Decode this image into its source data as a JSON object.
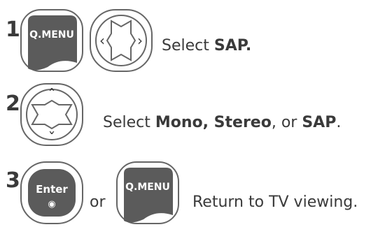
{
  "steps": [
    {
      "number": "1",
      "buttons": {
        "qmenu_label": "Q.MENU",
        "left_arrow": "‹",
        "right_arrow": "›"
      },
      "instruction": {
        "prefix": "Select ",
        "bold": "SAP."
      }
    },
    {
      "number": "2",
      "buttons": {
        "up_arrow": "ˆ",
        "down_arrow": "ˇ"
      },
      "instruction": {
        "prefix": "Select ",
        "bold1": "Mono, Stereo",
        "mid": ", or ",
        "bold2": "SAP",
        "suffix": "."
      }
    },
    {
      "number": "3",
      "buttons": {
        "enter_label": "Enter",
        "enter_dot": "◉",
        "or_label": "or",
        "qmenu_label": "Q.MENU"
      },
      "instruction": {
        "text": "Return to TV viewing."
      }
    }
  ],
  "colors": {
    "text": "#3a3a3a",
    "outline": "#666666",
    "button_fill": "#5b5b5b",
    "button_text": "#ffffff"
  }
}
